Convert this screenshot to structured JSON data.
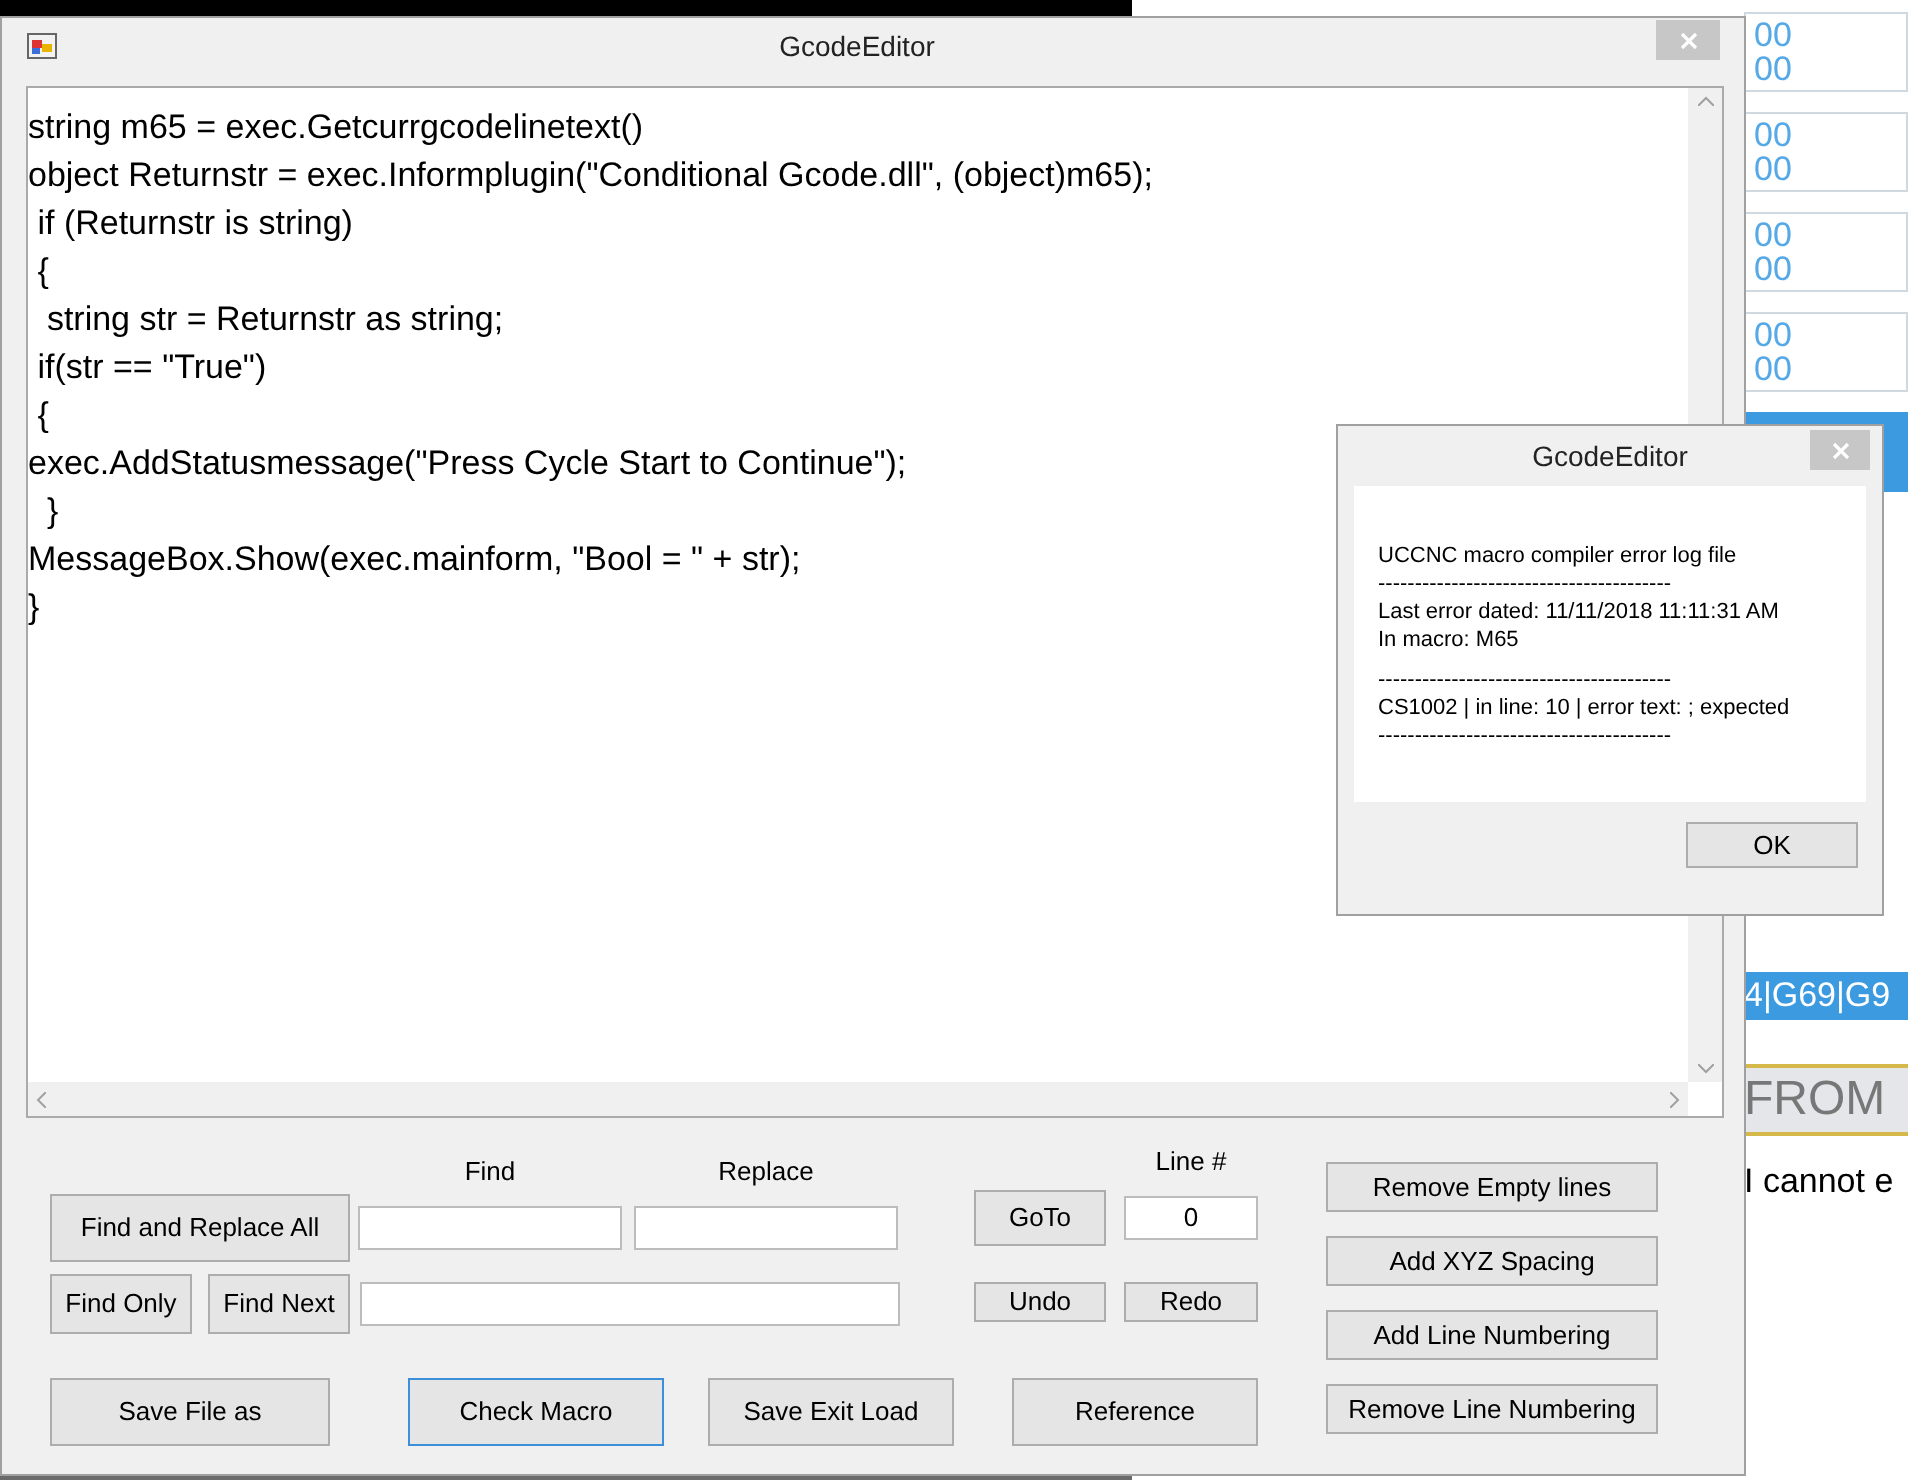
{
  "background_app": {
    "readouts": [
      [
        "00",
        "00"
      ],
      [
        "00",
        "00"
      ],
      [
        "00",
        "00"
      ],
      [
        "00",
        "00"
      ]
    ],
    "code_bar": "4|G69|G9",
    "banner": "FROM",
    "message": "I cannot e"
  },
  "main_window": {
    "title": "GcodeEditor",
    "code_lines": [
      "string m65 = exec.Getcurrgcodelinetext()",
      "object Returnstr = exec.Informplugin(\"Conditional Gcode.dll\", (object)m65);",
      " if (Returnstr is string)",
      " {",
      "  string str = Returnstr as string;",
      " if(str == \"True\")",
      " {",
      "exec.AddStatusmessage(\"Press Cycle Start to Continue\");",
      "  }",
      "MessageBox.Show(exec.mainform, \"Bool = \" + str);",
      "}"
    ],
    "find_label": "Find",
    "replace_label": "Replace",
    "line_label": "Line #",
    "line_value": "0",
    "find_replace_all": "Find and Replace All",
    "find_only": "Find Only",
    "find_next": "Find Next",
    "goto": "GoTo",
    "undo": "Undo",
    "redo": "Redo",
    "bottom_buttons": [
      {
        "label": "Save File as",
        "focused": false
      },
      {
        "label": "Check Macro",
        "focused": true
      },
      {
        "label": "Save Exit Load",
        "focused": false
      },
      {
        "label": "Reference",
        "focused": false
      }
    ],
    "tool_buttons": [
      "Remove Empty lines",
      "Add XYZ Spacing",
      "Add Line Numbering",
      "Remove Line Numbering"
    ]
  },
  "dialog": {
    "title": "GcodeEditor",
    "lines": [
      "UCCNC macro compiler error log file",
      "----------------------------------------",
      "Last error dated: 11/11/2018 11:11:31 AM",
      "In macro: M65",
      "----------------------------------------",
      "CS1002 | in line: 10 | error text: ; expected",
      "----------------------------------------"
    ],
    "ok": "OK"
  }
}
